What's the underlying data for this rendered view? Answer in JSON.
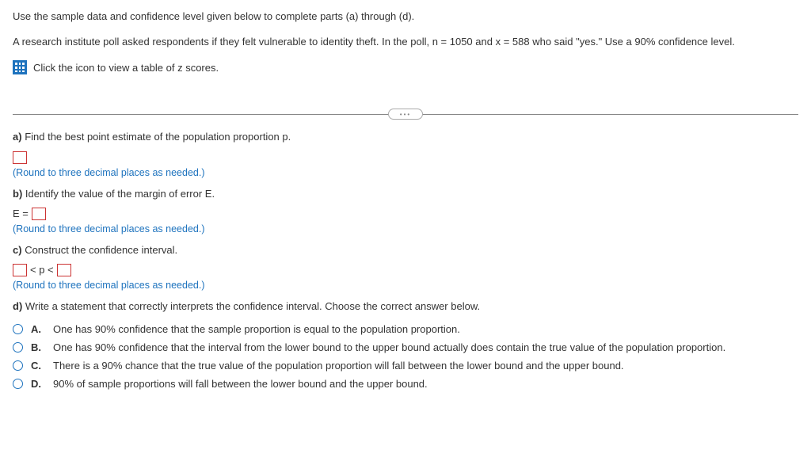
{
  "intro": {
    "line1": "Use the sample data and confidence level given below to complete parts (a) through (d).",
    "line2": "A research institute poll asked respondents if they felt vulnerable to identity theft. In the poll, n = 1050 and x = 588 who said \"yes.\" Use a 90% confidence level.",
    "icon_hint": "Click the icon to view a table of z scores."
  },
  "parts": {
    "a": {
      "label": "a)",
      "text": "Find the best point estimate of the population proportion p.",
      "hint": "(Round to three decimal places as needed.)"
    },
    "b": {
      "label": "b)",
      "text": "Identify the value of the margin of error E.",
      "eq_left": "E =",
      "hint": "(Round to three decimal places as needed.)"
    },
    "c": {
      "label": "c)",
      "text": "Construct the confidence interval.",
      "mid": "< p <",
      "hint": "(Round to three decimal places as needed.)"
    },
    "d": {
      "label": "d)",
      "text": "Write a statement that correctly interprets the confidence interval. Choose the correct answer below."
    }
  },
  "choices": [
    {
      "letter": "A.",
      "text": "One has 90% confidence that the sample proportion is equal to the population proportion."
    },
    {
      "letter": "B.",
      "text": "One has 90% confidence that the interval from the lower bound to the upper bound actually does contain the true value of the population proportion."
    },
    {
      "letter": "C.",
      "text": "There is a 90% chance that the true value of the population proportion will fall between the lower bound and the upper bound."
    },
    {
      "letter": "D.",
      "text": "90% of sample proportions will fall between the lower bound and the upper bound."
    }
  ],
  "expand": "•••"
}
